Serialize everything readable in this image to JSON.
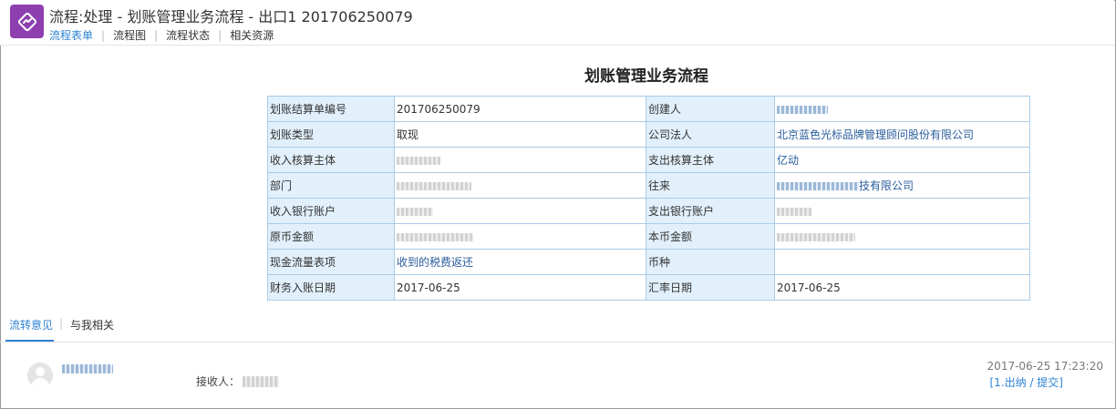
{
  "window": {
    "title": "流程:处理 - 划账管理业务流程 - 出口1 201706250079"
  },
  "tabs": [
    {
      "label": "流程表单",
      "active": true
    },
    {
      "label": "流程图",
      "active": false
    },
    {
      "label": "流程状态",
      "active": false
    },
    {
      "label": "相关资源",
      "active": false
    }
  ],
  "form": {
    "title": "划账管理业务流程",
    "rows": [
      {
        "l1": "划账结算单编号",
        "v1": "201706250079",
        "l2": "创建人",
        "v2": ""
      },
      {
        "l1": "划账类型",
        "v1": "取现",
        "l2": "公司法人",
        "v2": "北京蓝色光标品牌管理顾问股份有限公司"
      },
      {
        "l1": "收入核算主体",
        "v1": "",
        "l2": "支出核算主体",
        "v2": "亿动"
      },
      {
        "l1": "部门",
        "v1": "",
        "l2": "往来",
        "v2": "技有限公司"
      },
      {
        "l1": "收入银行账户",
        "v1": "",
        "l2": "支出银行账户",
        "v2": ""
      },
      {
        "l1": "原币金额",
        "v1": "",
        "l2": "本币金额",
        "v2": ""
      },
      {
        "l1": "现金流量表项",
        "v1": "收到的税费返还",
        "l2": "币种",
        "v2": ""
      },
      {
        "l1": "财务入账日期",
        "v1": "2017-06-25",
        "l2": "汇率日期",
        "v2": "2017-06-25"
      }
    ]
  },
  "bottom_tabs": [
    {
      "label": "流转意见",
      "active": true
    },
    {
      "label": "与我相关",
      "active": false
    }
  ],
  "comment": {
    "receiver_label": "接收人：",
    "timestamp": "2017-06-25  17:23:20",
    "step": "[1.出纳 / 提交]"
  },
  "colors": {
    "accent": "#2f83d3",
    "logo_bg": "#8d3fb0",
    "label_bg": "#e2f0fb",
    "table_border": "#a9cce8",
    "link_text": "#2a5d9c"
  },
  "icons": [
    "workflow-logo-icon",
    "user-avatar-icon"
  ]
}
